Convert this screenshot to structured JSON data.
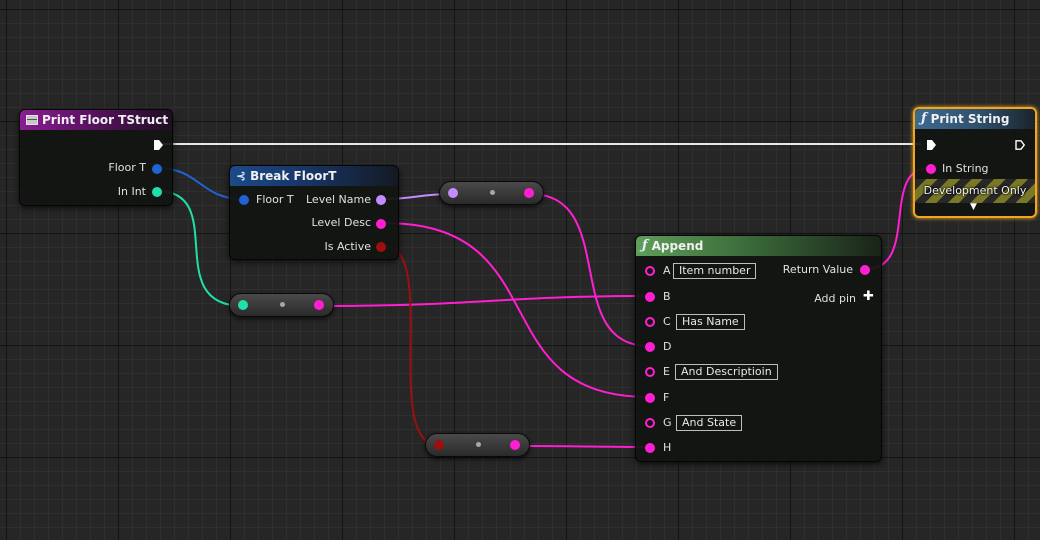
{
  "colors": {
    "exec": "#ffffff",
    "string": "#ff1fd0",
    "name": "#c58cff",
    "struct": "#1f63d4",
    "int": "#1fe0a8",
    "bool": "#9e0f0f",
    "selected_outline": "#f0a623"
  },
  "nodes": {
    "print_floor": {
      "title": "Print Floor TStruct",
      "icon": "struct-event-icon",
      "pins": {
        "floor_t": "Floor T",
        "in_int": "In Int"
      }
    },
    "break_floor": {
      "title": "Break FloorT",
      "icon": "break-struct-icon",
      "pins": {
        "floor_t": "Floor T",
        "level_name": "Level Name",
        "level_desc": "Level Desc",
        "is_active": "Is Active"
      }
    },
    "print_string": {
      "title": "Print String",
      "icon": "function-icon",
      "pins": {
        "in_string": "In String"
      },
      "footer": "Development Only",
      "expand_icon": "expand-arrow-icon"
    },
    "append": {
      "title": "Append",
      "icon": "function-icon",
      "pins": {
        "a": "A",
        "a_value": "Item number",
        "b": "B",
        "c": "C",
        "c_value": "Has Name",
        "d": "D",
        "e": "E",
        "e_value": "And Descriptioin",
        "f": "F",
        "g": "G",
        "g_value": "And State",
        "h": "H",
        "return_value": "Return Value",
        "add_pin": "Add pin"
      }
    }
  },
  "reroute_nodes": [
    "conversion-name-to-string",
    "conversion-int-to-string",
    "conversion-bool-to-string"
  ]
}
